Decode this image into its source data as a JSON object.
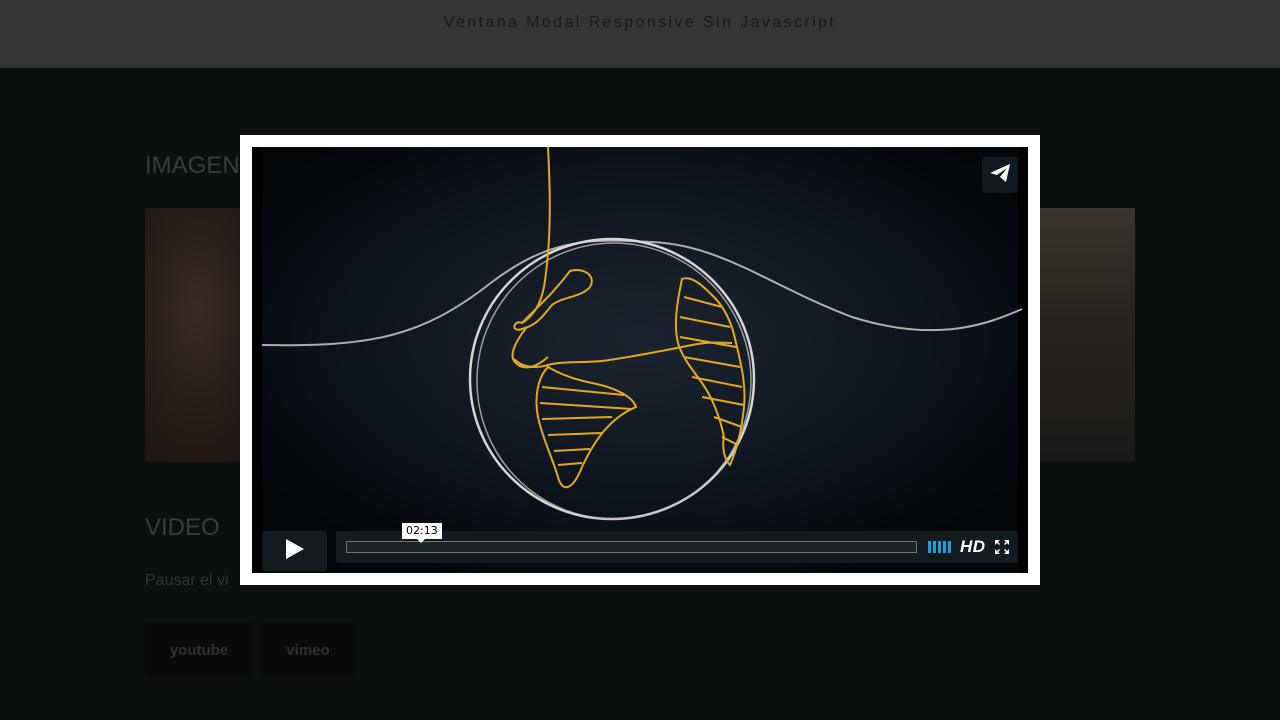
{
  "header": {
    "title": "Ventana Modal Responsive Sin Javascript"
  },
  "sections": {
    "imagen": {
      "heading": "IMAGEN"
    },
    "video": {
      "heading": "VIDEO",
      "caption": "Pausar el vi"
    }
  },
  "buttons": {
    "youtube": "youtube",
    "vimeo": "vimeo"
  },
  "player": {
    "time": "02:13",
    "quality": "HD",
    "volume_bars": 5,
    "progress": 0,
    "icons": {
      "share": "send-icon",
      "play": "play-icon",
      "volume": "volume-icon",
      "fullscreen": "fullscreen-icon"
    },
    "colors": {
      "volume": "#1a9fe0",
      "thread": "#e3a925",
      "globe": "#d9d9d9",
      "background": "#0d1520"
    }
  }
}
